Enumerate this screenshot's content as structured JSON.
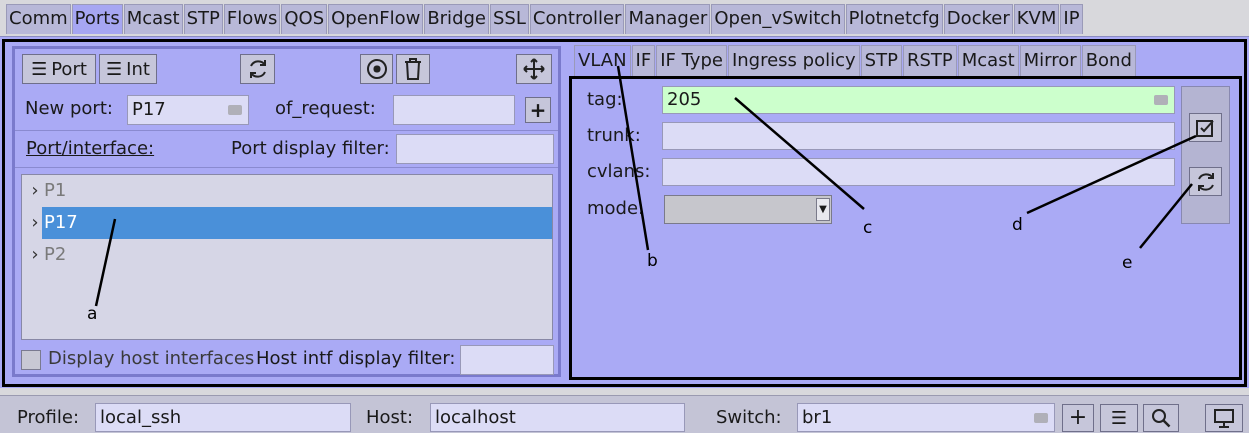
{
  "top_tabs": [
    "Comm",
    "Ports",
    "Mcast",
    "STP",
    "Flows",
    "QOS",
    "OpenFlow",
    "Bridge",
    "SSL",
    "Controller",
    "Manager",
    "Open_vSwitch",
    "Plotnetcfg",
    "Docker",
    "KVM",
    "IP"
  ],
  "active_top_tab": "Ports",
  "toolbar": {
    "port_label": "Port",
    "int_label": "Int"
  },
  "new_port": {
    "label": "New port:",
    "value": "P17",
    "of_request_label": "of_request:",
    "of_request_value": ""
  },
  "filter": {
    "port_interface_label": "Port/interface:",
    "port_display_filter_label": "Port display filter:",
    "port_display_filter_value": ""
  },
  "ports": [
    {
      "name": "P1",
      "selected": false
    },
    {
      "name": "P17",
      "selected": true
    },
    {
      "name": "P2",
      "selected": false
    }
  ],
  "host_filter": {
    "checkbox_label": "Display host interfaces",
    "checked": false,
    "filter_label": "Host intf display filter:",
    "filter_value": ""
  },
  "sub_tabs": [
    "VLAN",
    "IF",
    "IF Type",
    "Ingress policy",
    "STP",
    "RSTP",
    "Mcast",
    "Mirror",
    "Bond"
  ],
  "active_sub_tab": "VLAN",
  "vlan": {
    "tag_label": "tag:",
    "tag_value": "205",
    "trunk_label": "trunk:",
    "trunk_value": "",
    "cvlans_label": "cvlans:",
    "cvlans_value": "",
    "mode_label": "mode:",
    "mode_value": ""
  },
  "bottom": {
    "profile_label": "Profile:",
    "profile_value": "local_ssh",
    "host_label": "Host:",
    "host_value": "localhost",
    "switch_label": "Switch:",
    "switch_value": "br1"
  },
  "annotations": [
    "a",
    "b",
    "c",
    "d",
    "e"
  ],
  "colors": {
    "panel_bg": "#aaaaf5",
    "selection": "#4a90d9",
    "tag_field_bg": "#ccffcc"
  }
}
